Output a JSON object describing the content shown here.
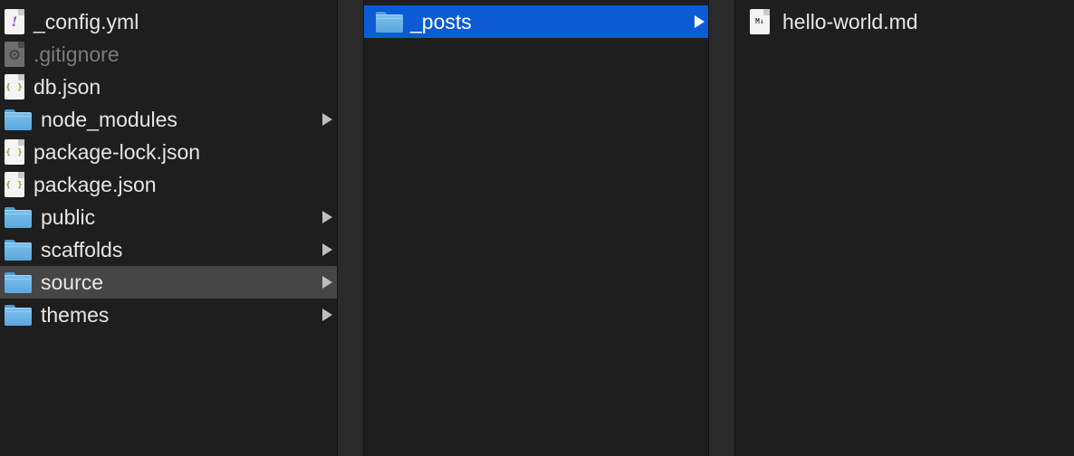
{
  "columns": [
    {
      "items": [
        {
          "name": "_config.yml",
          "kind": "file",
          "icon": "yaml-file-icon",
          "glyph": "!",
          "has_children": false
        },
        {
          "name": ".gitignore",
          "kind": "file",
          "icon": "gear-file-icon",
          "glyph": "⚙",
          "has_children": false,
          "dimmed": true
        },
        {
          "name": "db.json",
          "kind": "file",
          "icon": "json-file-icon",
          "glyph": "{ }",
          "has_children": false
        },
        {
          "name": "node_modules",
          "kind": "folder",
          "icon": "folder-icon",
          "has_children": true
        },
        {
          "name": "package-lock.json",
          "kind": "file",
          "icon": "json-file-icon",
          "glyph": "{ }",
          "has_children": false
        },
        {
          "name": "package.json",
          "kind": "file",
          "icon": "json-file-icon",
          "glyph": "{ }",
          "has_children": false
        },
        {
          "name": "public",
          "kind": "folder",
          "icon": "folder-icon",
          "has_children": true
        },
        {
          "name": "scaffolds",
          "kind": "folder",
          "icon": "folder-icon",
          "has_children": true
        },
        {
          "name": "source",
          "kind": "folder",
          "icon": "folder-icon",
          "has_children": true,
          "selected": "inactive"
        },
        {
          "name": "themes",
          "kind": "folder",
          "icon": "folder-icon",
          "has_children": true
        }
      ]
    },
    {
      "items": [
        {
          "name": "_posts",
          "kind": "folder",
          "icon": "folder-icon",
          "has_children": true,
          "selected": "active"
        }
      ]
    },
    {
      "items": [
        {
          "name": "hello-world.md",
          "kind": "file",
          "icon": "markdown-file-icon",
          "glyph": "M↓",
          "has_children": false
        }
      ]
    }
  ],
  "colors": {
    "background": "#1e1e1e",
    "selection_active": "#0a5bd4",
    "selection_inactive": "#464646",
    "folder": "#6ab3e5"
  }
}
